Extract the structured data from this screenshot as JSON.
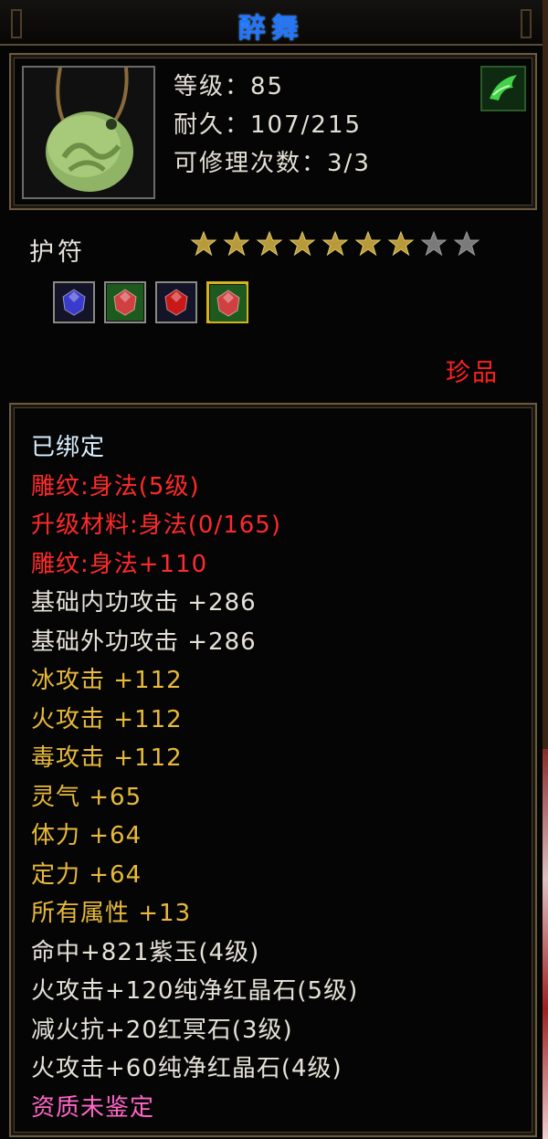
{
  "item": {
    "name": "醉舞",
    "level_label": "等级：",
    "level": "85",
    "durability_label": "耐久：",
    "durability": "107/215",
    "repair_label": "可修理次数：",
    "repair_count": "3/3",
    "type": "护符",
    "stars_filled": 7,
    "stars_total": 9,
    "rarity": "珍品",
    "icon": "jade-pendant-icon",
    "badge_icon": "green-wind-emblem-icon"
  },
  "gems": [
    {
      "icon": "purple-jade-gem-icon",
      "color": "#3a3acc",
      "selected": false
    },
    {
      "icon": "pure-red-crystal-gem-icon",
      "color": "#d04040",
      "selected": false
    },
    {
      "icon": "red-dark-stone-gem-icon",
      "color": "#c81818",
      "selected": false
    },
    {
      "icon": "pure-red-crystal-gem-icon",
      "color": "#d04040",
      "selected": true
    }
  ],
  "details": [
    {
      "text": "已绑定",
      "style": "bound"
    },
    {
      "text": "雕纹:身法(5级)",
      "style": "red"
    },
    {
      "text": "升级材料:身法(0/165)",
      "style": "red"
    },
    {
      "text": "雕纹:身法+110",
      "style": "red"
    },
    {
      "text": "基础内功攻击 +286",
      "style": "white"
    },
    {
      "text": "基础外功攻击 +286",
      "style": "white"
    },
    {
      "text": "冰攻击 +112",
      "style": "gold"
    },
    {
      "text": "火攻击 +112",
      "style": "gold"
    },
    {
      "text": "毒攻击 +112",
      "style": "gold"
    },
    {
      "text": "灵气 +65",
      "style": "gold"
    },
    {
      "text": "体力 +64",
      "style": "gold"
    },
    {
      "text": "定力 +64",
      "style": "gold"
    },
    {
      "text": "所有属性 +13",
      "style": "gold"
    },
    {
      "text": "命中+821紫玉(4级)",
      "style": "white"
    },
    {
      "text": "火攻击+120纯净红晶石(5级)",
      "style": "white"
    },
    {
      "text": "减火抗+20红冥石(3级)",
      "style": "white"
    },
    {
      "text": "火攻击+60纯净红晶石(4级)",
      "style": "white"
    },
    {
      "text": "资质未鉴定",
      "style": "pink"
    }
  ],
  "colors": {
    "title": "#1f76ff",
    "red": "#ff2a2a",
    "gold": "#e8b93a",
    "white": "#e6e2d8",
    "pink": "#ff66c8",
    "star_on": "#b89a3a",
    "star_off": "#7a7a7a"
  }
}
